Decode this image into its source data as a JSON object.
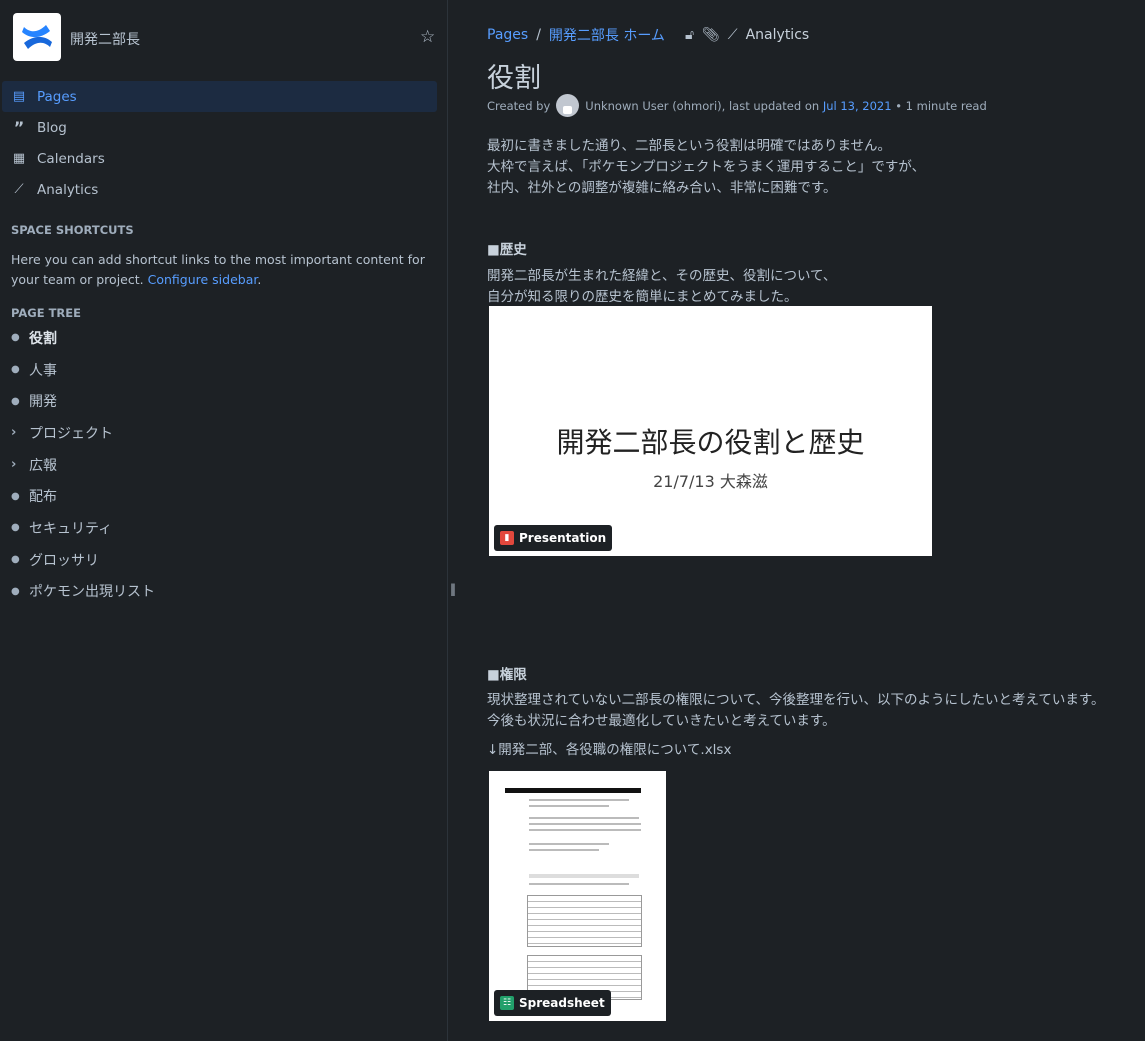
{
  "sidebar": {
    "space_name": "開発二部長",
    "nav": [
      {
        "label": "Pages",
        "icon": "page-icon"
      },
      {
        "label": "Blog",
        "icon": "quote-icon"
      },
      {
        "label": "Calendars",
        "icon": "calendar-icon"
      },
      {
        "label": "Analytics",
        "icon": "analytics-icon"
      }
    ],
    "shortcuts_heading": "SPACE SHORTCUTS",
    "shortcuts_text": "Here you can add shortcut links to the most important content for your team or project.",
    "configure_link": "Configure sidebar",
    "page_tree_heading": "PAGE TREE",
    "tree": [
      {
        "label": "役割",
        "type": "bullet"
      },
      {
        "label": "人事",
        "type": "bullet"
      },
      {
        "label": "開発",
        "type": "bullet"
      },
      {
        "label": "プロジェクト",
        "type": "chevron"
      },
      {
        "label": "広報",
        "type": "chevron"
      },
      {
        "label": "配布",
        "type": "bullet"
      },
      {
        "label": "セキュリティ",
        "type": "bullet"
      },
      {
        "label": "グロッサリ",
        "type": "bullet"
      },
      {
        "label": "ポケモン出現リスト",
        "type": "bullet"
      }
    ]
  },
  "breadcrumb": {
    "root": "Pages",
    "sep": "/",
    "parent": "開発二部長 ホーム",
    "analytics": "Analytics"
  },
  "page": {
    "title": "役割",
    "created_by": "Created by",
    "author": "Unknown User (ohmori), last updated on",
    "date": "Jul 13, 2021",
    "read": "• 1 minute read",
    "intro": [
      "最初に書きました通り、二部長という役割は明確ではありません。",
      "大枠で言えば、「ポケモンプロジェクトをうまく運用すること」ですが、",
      "社内、社外との調整が複雑に絡み合い、非常に困難です。"
    ],
    "history_heading": "■歴史",
    "history_text": [
      "開発二部長が生まれた経緯と、その歴史、役割について、",
      "自分が知る限りの歴史を簡単にまとめてみました。"
    ],
    "presentation": {
      "title": "開発二部長の役割と歴史",
      "subtitle": "21/7/13 大森滋",
      "badge": "Presentation"
    },
    "authority_heading": "■権限",
    "authority_text": [
      "現状整理されていない二部長の権限について、今後整理を行い、以下のようにしたいと考えています。",
      "今後も状況に合わせ最適化していきたいと考えています。"
    ],
    "file_label": "↓開発二部、各役職の権限について.xlsx",
    "spreadsheet": {
      "badge": "Spreadsheet"
    }
  },
  "colors": {
    "accent": "#579dff",
    "bg": "#1d2125",
    "selected": "#1c2b41"
  }
}
